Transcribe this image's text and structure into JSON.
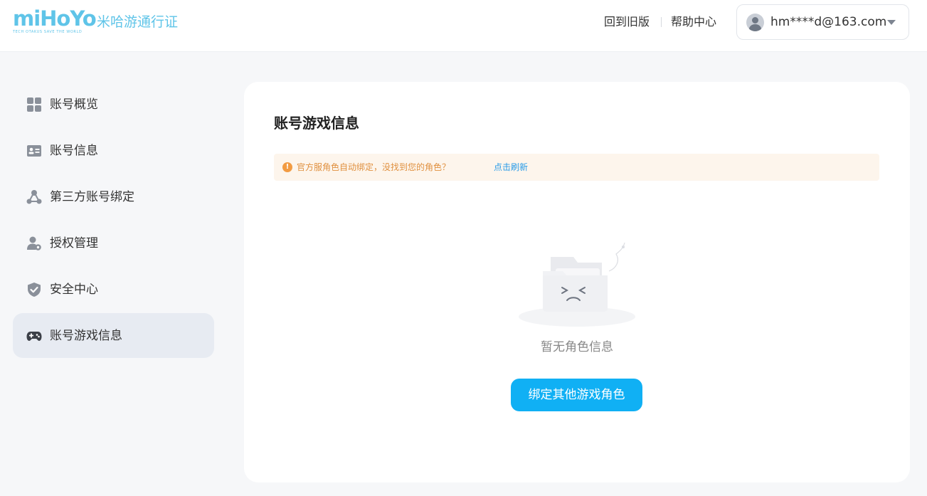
{
  "header": {
    "logo_text": "miHoYo",
    "logo_tagline": "TECH OTAKUS SAVE THE WORLD",
    "brand_name": "米哈游通行证",
    "links": {
      "old_version": "回到旧版",
      "help_center": "帮助中心"
    },
    "user": {
      "email": "hm****d@163.com",
      "avatar_icon": "user-avatar-icon",
      "menu_icon": "caret-down-icon"
    }
  },
  "sidebar": {
    "active_index": 5,
    "items": [
      {
        "label": "账号概览",
        "icon": "grid-icon"
      },
      {
        "label": "账号信息",
        "icon": "id-card-icon"
      },
      {
        "label": "第三方账号绑定",
        "icon": "share-nodes-icon"
      },
      {
        "label": "授权管理",
        "icon": "user-gear-icon"
      },
      {
        "label": "安全中心",
        "icon": "shield-check-icon"
      },
      {
        "label": "账号游戏信息",
        "icon": "gamepad-icon"
      }
    ]
  },
  "main": {
    "title": "账号游戏信息",
    "notice": {
      "text": "官方服角色自动绑定，没找到您的角色？",
      "link": "点击刷新",
      "icon": "info-exclamation-icon"
    },
    "empty": {
      "text": "暂无角色信息",
      "icon": "empty-folder-icon"
    },
    "bind_button": "绑定其他游戏角色"
  },
  "colors": {
    "brand": "#5fc4e8",
    "primary_button": "#10b0f4",
    "notice_bg": "#fdf5ec",
    "notice_text": "#e0903f",
    "link": "#2a9ce8",
    "active_item_bg": "#e7ebf2"
  }
}
